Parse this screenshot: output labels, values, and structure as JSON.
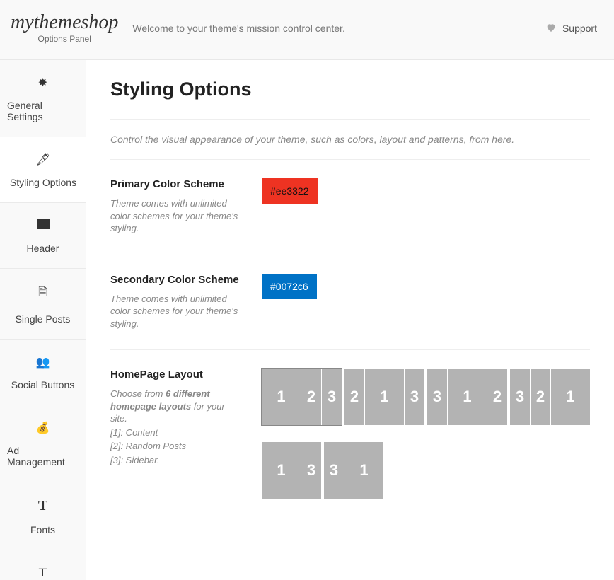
{
  "header": {
    "logo": "mythemeshop",
    "logo_sub": "Options Panel",
    "welcome": "Welcome to your theme's mission control center.",
    "support": "Support"
  },
  "sidebar": {
    "items": [
      {
        "label": "General Settings",
        "icon": "⚙"
      },
      {
        "label": "Styling Options",
        "icon": "🖌"
      },
      {
        "label": "Header",
        "icon": "▬"
      },
      {
        "label": "Single Posts",
        "icon": "📄"
      },
      {
        "label": "Social Buttons",
        "icon": "👥"
      },
      {
        "label": "Ad Management",
        "icon": "💰"
      },
      {
        "label": "Fonts",
        "icon": "T"
      }
    ],
    "active_index": 1
  },
  "page": {
    "title": "Styling Options",
    "intro": "Control the visual appearance of your theme, such as colors, layout and patterns, from here."
  },
  "options": {
    "primary": {
      "title": "Primary Color Scheme",
      "desc": "Theme comes with unlimited color schemes for your theme's styling.",
      "value": "#ee3322"
    },
    "secondary": {
      "title": "Secondary Color Scheme",
      "desc": "Theme comes with unlimited color schemes for your theme's styling.",
      "value": "#0072c6"
    },
    "layout": {
      "title": "HomePage Layout",
      "desc_prefix": "Choose from ",
      "desc_bold": "6 different homepage layouts",
      "desc_suffix": " for your site.",
      "legend1": "[1]: Content",
      "legend2": "[2]: Random Posts",
      "legend3": "[3]: Sidebar.",
      "variants": [
        [
          {
            "n": "1",
            "w": "md"
          },
          {
            "n": "2",
            "w": "sm"
          },
          {
            "n": "3",
            "w": "sm"
          }
        ],
        [
          {
            "n": "2",
            "w": "sm"
          },
          {
            "n": "1",
            "w": "md"
          },
          {
            "n": "3",
            "w": "sm"
          }
        ],
        [
          {
            "n": "3",
            "w": "sm"
          },
          {
            "n": "1",
            "w": "md"
          },
          {
            "n": "2",
            "w": "sm"
          }
        ],
        [
          {
            "n": "3",
            "w": "sm"
          },
          {
            "n": "2",
            "w": "sm"
          },
          {
            "n": "1",
            "w": "md"
          }
        ],
        [
          {
            "n": "1",
            "w": "md"
          },
          {
            "n": "3",
            "w": "sm"
          }
        ],
        [
          {
            "n": "3",
            "w": "sm"
          },
          {
            "n": "1",
            "w": "md"
          }
        ]
      ],
      "selected": 0
    }
  }
}
